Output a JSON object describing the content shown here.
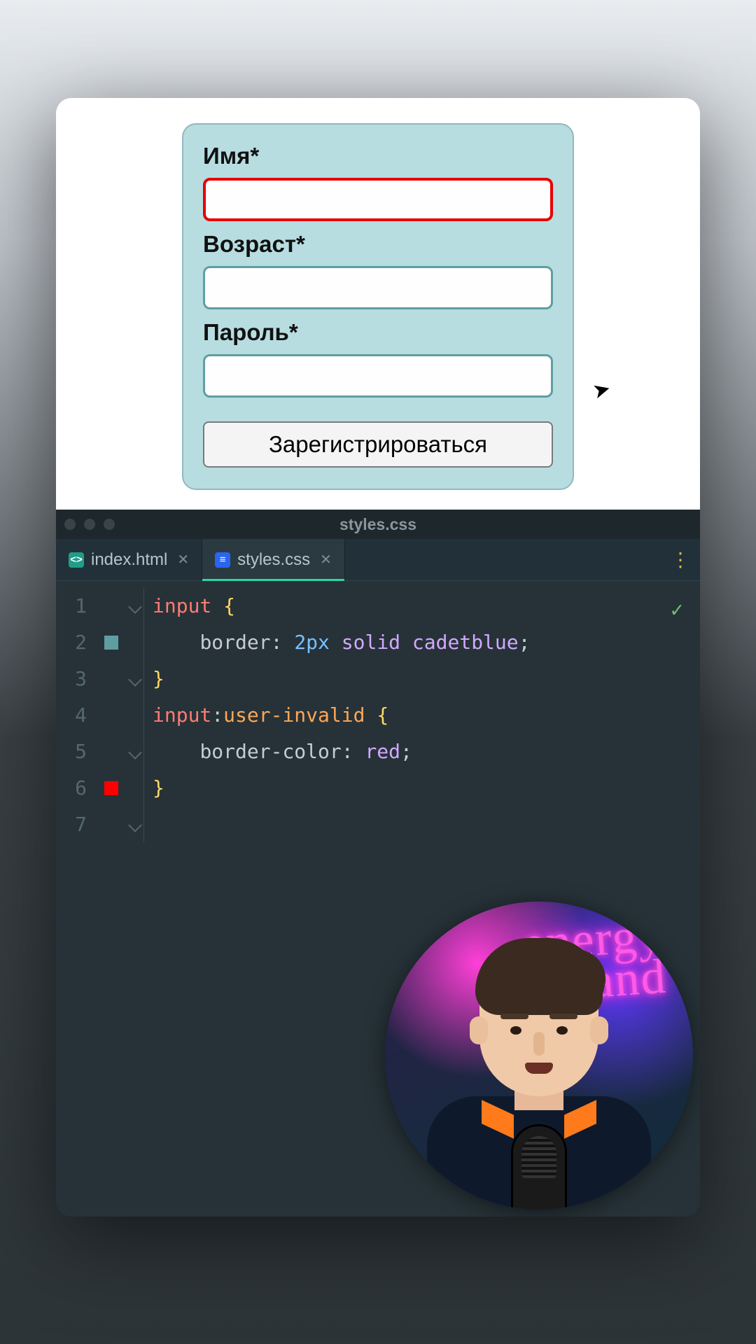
{
  "form": {
    "fields": [
      {
        "label": "Имя*",
        "invalid": true
      },
      {
        "label": "Возраст*",
        "invalid": false
      },
      {
        "label": "Пароль*",
        "invalid": false
      }
    ],
    "submit_label": "Зарегистрироваться"
  },
  "editor": {
    "window_title": "styles.css",
    "tabs": [
      {
        "label": "index.html",
        "icon": "html",
        "active": false
      },
      {
        "label": "styles.css",
        "icon": "css",
        "active": true
      }
    ],
    "line_numbers": [
      "1",
      "2",
      "3",
      "4",
      "5",
      "6",
      "7"
    ],
    "code_lines": [
      {
        "tokens": [
          {
            "t": "input",
            "c": "tk-tag"
          },
          {
            "t": " ",
            "c": "tk-punc"
          },
          {
            "t": "{",
            "c": "tk-brace"
          }
        ]
      },
      {
        "swatch": "cadet",
        "tokens": [
          {
            "t": "    ",
            "c": ""
          },
          {
            "t": "border",
            "c": "tk-prop"
          },
          {
            "t": ": ",
            "c": "tk-punc"
          },
          {
            "t": "2px",
            "c": "tk-num"
          },
          {
            "t": " ",
            "c": ""
          },
          {
            "t": "solid",
            "c": "tk-kw"
          },
          {
            "t": " ",
            "c": ""
          },
          {
            "t": "cadetblue",
            "c": "tk-kw"
          },
          {
            "t": ";",
            "c": "tk-punc"
          }
        ]
      },
      {
        "tokens": [
          {
            "t": "}",
            "c": "tk-brace"
          }
        ]
      },
      {
        "tokens": [
          {
            "t": "",
            "c": ""
          }
        ]
      },
      {
        "tokens": [
          {
            "t": "input",
            "c": "tk-tag"
          },
          {
            "t": ":",
            "c": "tk-punc"
          },
          {
            "t": "user-invalid",
            "c": "tk-pseudo"
          },
          {
            "t": " ",
            "c": ""
          },
          {
            "t": "{",
            "c": "tk-brace"
          }
        ]
      },
      {
        "swatch": "red",
        "tokens": [
          {
            "t": "    ",
            "c": ""
          },
          {
            "t": "border-color",
            "c": "tk-prop"
          },
          {
            "t": ": ",
            "c": "tk-punc"
          },
          {
            "t": "red",
            "c": "tk-kw"
          },
          {
            "t": ";",
            "c": "tk-punc"
          }
        ]
      },
      {
        "tokens": [
          {
            "t": "}",
            "c": "tk-brace"
          }
        ]
      }
    ],
    "colors": {
      "cadetblue": "#5f9ea0",
      "red": "#ff0000"
    }
  },
  "avatar": {
    "neon_text_line1": "energy",
    "neon_text_line2": "ronband"
  }
}
